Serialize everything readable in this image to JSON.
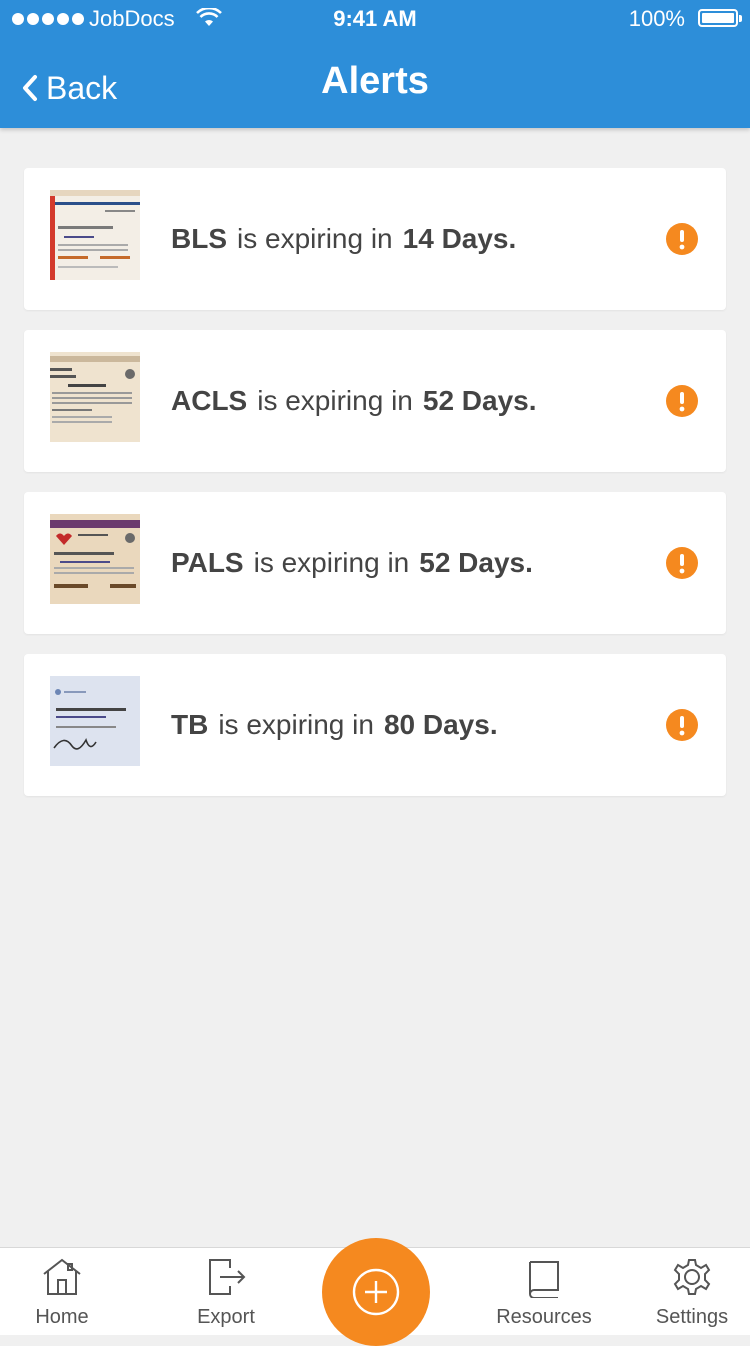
{
  "status_bar": {
    "carrier": "JobDocs",
    "time": "9:41 AM",
    "battery": "100%"
  },
  "header": {
    "back_label": "Back",
    "title": "Alerts"
  },
  "alerts": [
    {
      "name": "BLS",
      "text": "is expiring in",
      "days": "14 Days."
    },
    {
      "name": "ACLS",
      "text": "is expiring in",
      "days": "52 Days."
    },
    {
      "name": "PALS",
      "text": "is expiring in",
      "days": "52 Days."
    },
    {
      "name": "TB",
      "text": "is expiring in",
      "days": "80 Days."
    }
  ],
  "tabbar": {
    "home": "Home",
    "export": "Export",
    "resources": "Resources",
    "settings": "Settings"
  },
  "colors": {
    "header": "#2d8ed9",
    "accent": "#f5891f"
  },
  "icons": [
    "back-chevron-icon",
    "alert-icon",
    "home-icon",
    "export-icon",
    "add-icon",
    "resources-icon",
    "settings-icon"
  ]
}
